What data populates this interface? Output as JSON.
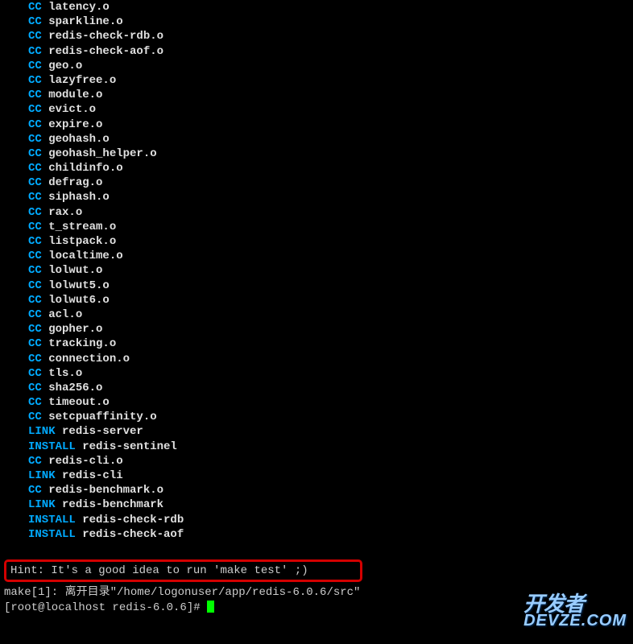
{
  "compile_lines": [
    {
      "cmd": "CC",
      "file": "latency.o"
    },
    {
      "cmd": "CC",
      "file": "sparkline.o"
    },
    {
      "cmd": "CC",
      "file": "redis-check-rdb.o"
    },
    {
      "cmd": "CC",
      "file": "redis-check-aof.o"
    },
    {
      "cmd": "CC",
      "file": "geo.o"
    },
    {
      "cmd": "CC",
      "file": "lazyfree.o"
    },
    {
      "cmd": "CC",
      "file": "module.o"
    },
    {
      "cmd": "CC",
      "file": "evict.o"
    },
    {
      "cmd": "CC",
      "file": "expire.o"
    },
    {
      "cmd": "CC",
      "file": "geohash.o"
    },
    {
      "cmd": "CC",
      "file": "geohash_helper.o"
    },
    {
      "cmd": "CC",
      "file": "childinfo.o"
    },
    {
      "cmd": "CC",
      "file": "defrag.o"
    },
    {
      "cmd": "CC",
      "file": "siphash.o"
    },
    {
      "cmd": "CC",
      "file": "rax.o"
    },
    {
      "cmd": "CC",
      "file": "t_stream.o"
    },
    {
      "cmd": "CC",
      "file": "listpack.o"
    },
    {
      "cmd": "CC",
      "file": "localtime.o"
    },
    {
      "cmd": "CC",
      "file": "lolwut.o"
    },
    {
      "cmd": "CC",
      "file": "lolwut5.o"
    },
    {
      "cmd": "CC",
      "file": "lolwut6.o"
    },
    {
      "cmd": "CC",
      "file": "acl.o"
    },
    {
      "cmd": "CC",
      "file": "gopher.o"
    },
    {
      "cmd": "CC",
      "file": "tracking.o"
    },
    {
      "cmd": "CC",
      "file": "connection.o"
    },
    {
      "cmd": "CC",
      "file": "tls.o"
    },
    {
      "cmd": "CC",
      "file": "sha256.o"
    },
    {
      "cmd": "CC",
      "file": "timeout.o"
    },
    {
      "cmd": "CC",
      "file": "setcpuaffinity.o"
    },
    {
      "cmd": "LINK",
      "file": "redis-server"
    },
    {
      "cmd": "INSTALL",
      "file": "redis-sentinel"
    },
    {
      "cmd": "CC",
      "file": "redis-cli.o"
    },
    {
      "cmd": "LINK",
      "file": "redis-cli"
    },
    {
      "cmd": "CC",
      "file": "redis-benchmark.o"
    },
    {
      "cmd": "LINK",
      "file": "redis-benchmark"
    },
    {
      "cmd": "INSTALL",
      "file": "redis-check-rdb"
    },
    {
      "cmd": "INSTALL",
      "file": "redis-check-aof"
    }
  ],
  "hint": "Hint: It's a good idea to run 'make test' ;)",
  "make_leave": "make[1]: 离开目录\"/home/logonuser/app/redis-6.0.6/src\"",
  "prompt": "[root@localhost redis-6.0.6]# ",
  "watermark": {
    "top": "开发者",
    "bottom": "DEVZE.COM"
  }
}
